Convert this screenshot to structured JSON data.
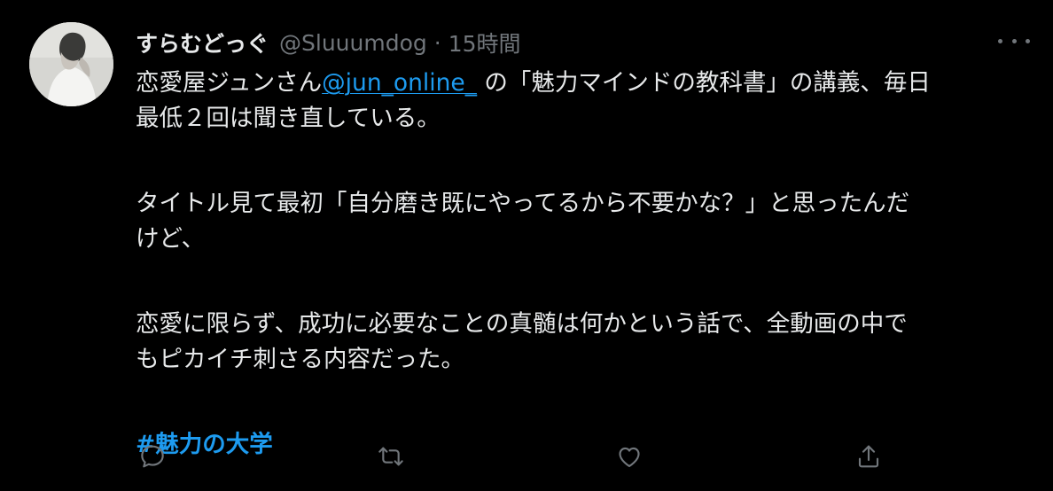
{
  "tweet": {
    "author": {
      "display_name": "すらむどっぐ",
      "handle": "@Sluuumdog",
      "separator": "·",
      "time": "15時間"
    },
    "body": {
      "p1_line1_before": "恋愛屋ジュンさん",
      "mention": "@jun_online_",
      "p1_line1_after": " の「魅力マインドの教科書」の講義、毎日",
      "p1_line2": "最低２回は聞き直している。",
      "p2_line1": "タイトル見て最初「自分磨き既にやってるから不要かな？」と思ったんだ",
      "p2_line2": "けど、",
      "p3_line1": "恋愛に限らず、成功に必要なことの真髄は何かという話で、全動画の中で",
      "p3_line2": "もピカイチ刺さる内容だった。",
      "hashtag": "#魅力の大学"
    },
    "icons": {
      "more": "more-horizontal-icon",
      "reply": "reply-icon",
      "retweet": "retweet-icon",
      "like": "heart-icon",
      "share": "share-icon"
    },
    "colors": {
      "background": "#000000",
      "text": "#e7e9ea",
      "secondary": "#71767b",
      "link": "#1d9bf0"
    }
  }
}
